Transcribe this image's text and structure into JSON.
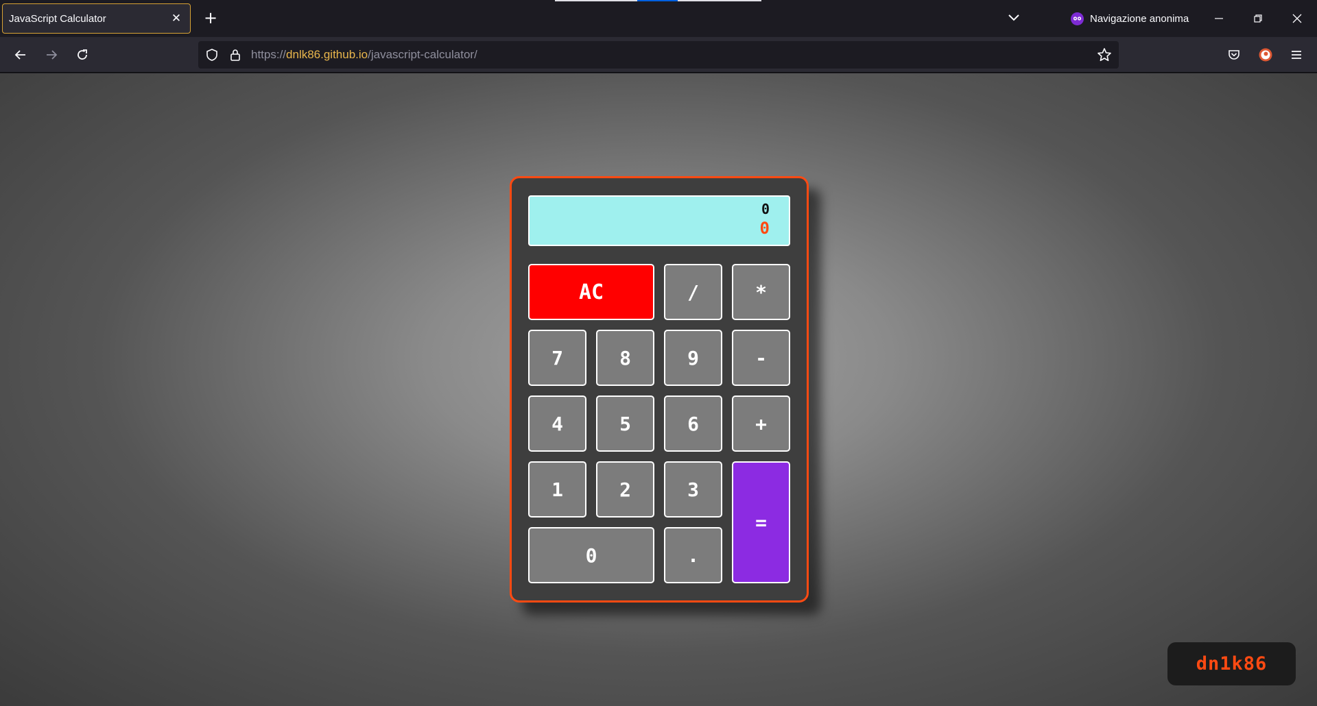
{
  "browser": {
    "tab_title": "JavaScript Calculator",
    "private_label": "Navigazione anonima",
    "url": {
      "scheme": "https://",
      "host": "dnlk86.github.io",
      "path": "/javascript-calculator/"
    }
  },
  "calculator": {
    "formula": "0",
    "result": "0",
    "keys": {
      "clear": "AC",
      "divide": "/",
      "multiply": "*",
      "seven": "7",
      "eight": "8",
      "nine": "9",
      "subtract": "-",
      "four": "4",
      "five": "5",
      "six": "6",
      "add": "+",
      "one": "1",
      "two": "2",
      "three": "3",
      "equals": "=",
      "zero": "0",
      "decimal": "."
    }
  },
  "badge": {
    "text": "dn1k86"
  },
  "colors": {
    "accent_orange": "#ff4a12",
    "display_bg": "#9ff0ee",
    "clear_key": "#ff0000",
    "equals_key": "#8c2be2",
    "key_bg": "#7c7c7c",
    "private_purple": "#7d2bd4",
    "host_highlight": "#e9b64c"
  }
}
